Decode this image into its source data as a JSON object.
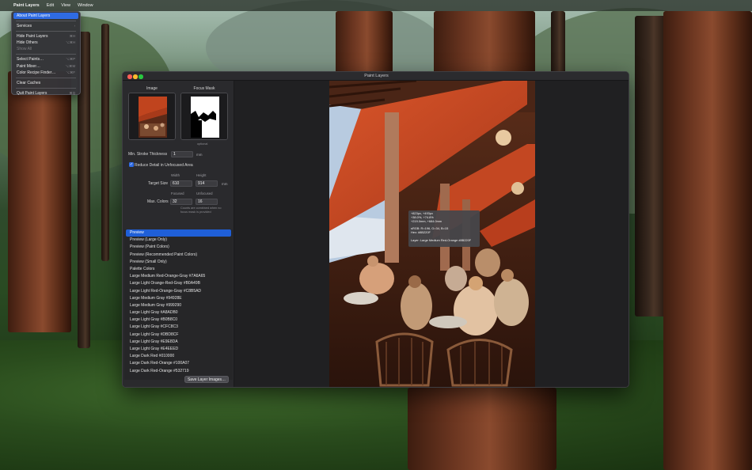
{
  "menubar": {
    "apple": "",
    "app": "Paint Layers",
    "items": [
      "Edit",
      "View",
      "Window"
    ]
  },
  "app_menu": {
    "items": [
      {
        "label": "About Paint Layers",
        "shortcut": "",
        "selected": true,
        "disabled": false
      },
      {
        "sep": true
      },
      {
        "label": "Services",
        "shortcut": "›",
        "disabled": false
      },
      {
        "sep": true
      },
      {
        "label": "Hide Paint Layers",
        "shortcut": "⌘H",
        "disabled": false
      },
      {
        "label": "Hide Others",
        "shortcut": "⌥⌘H",
        "disabled": false
      },
      {
        "label": "Show All",
        "shortcut": "",
        "disabled": true
      },
      {
        "sep": true
      },
      {
        "label": "Select Paints…",
        "shortcut": "⌥⌘P",
        "disabled": false
      },
      {
        "label": "Paint Mixer…",
        "shortcut": "⌥⌘M",
        "disabled": false
      },
      {
        "label": "Color Recipe Finder…",
        "shortcut": "⌥⌘F",
        "disabled": false
      },
      {
        "sep": true
      },
      {
        "label": "Clear Caches",
        "shortcut": "",
        "disabled": false
      },
      {
        "sep": true
      },
      {
        "label": "Quit Paint Layers",
        "shortcut": "⌘Q",
        "disabled": false
      }
    ]
  },
  "window": {
    "title": "Paint Layers",
    "traffic_colors": [
      "#ff5f57",
      "#febc2e",
      "#28c840"
    ]
  },
  "sidebar": {
    "image_label": "Image",
    "focus_mask_label": "Focus Mask",
    "optional_label": "optional",
    "min_stroke_label": "Min. Stroke Thickness",
    "min_stroke_value": "1",
    "min_stroke_unit": "mm",
    "reduce_detail_label": "Reduce Detail in Unfocused Area",
    "reduce_detail_checked": true,
    "width_label": "Width",
    "height_label": "Height",
    "target_size_label": "Target Size",
    "width_value": "610",
    "height_value": "914",
    "size_unit": "mm",
    "focused_label": "Focused",
    "unfocused_label": "Unfocused",
    "max_colors_label": "Max. Colors",
    "focused_value": "32",
    "unfocused_value": "16",
    "colors_note": "Counts are combined when no focus mask is provided",
    "save_button": "Save Layer Images…"
  },
  "layer_list": {
    "selected_index": 0,
    "items": [
      "Preview",
      "Preview (Large Only)",
      "Preview (Paint Colors)",
      "Preview (Recommended Paint Colors)",
      "Preview (Small Only)",
      "Palette Colors",
      "Large Medium Red-Orange-Gray #7A6A65",
      "Large Light Orange-Red-Gray #B0A49B",
      "Large Light Red-Orange-Gray #C8B5AD",
      "Large Medium Gray #94928E",
      "Large Medium Gray #999290",
      "Large Light Gray #A8ADB0",
      "Large Light Gray #B0B8C0",
      "Large Light Gray #CFC8C3",
      "Large Light Gray #DBD8CF",
      "Large Light Gray #E9E8DA",
      "Large Light Gray #E4EEED",
      "Large Dark Red #010000",
      "Large Dark Red-Orange #100A07",
      "Large Dark Red-Orange #532719"
    ]
  },
  "tooltip": {
    "lines": [
      "+823px, +493px",
      "+38.0%, +74.8%",
      "+219.0mm, +684.0mm",
      "",
      "sRGB: R=196, G=34, B=15",
      "Hex: #8B220F",
      "",
      "Layer: Large Medium Red-Orange #8B220F"
    ]
  }
}
